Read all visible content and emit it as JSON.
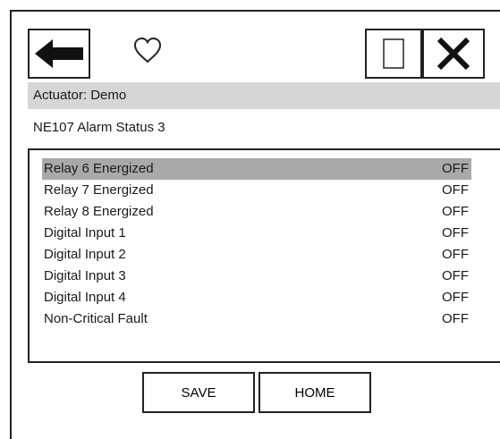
{
  "toolbar": {
    "back_icon": "back-arrow-icon",
    "favorite_icon": "heart-icon",
    "page_icon": "blank-page-icon",
    "close_icon": "close-x-icon"
  },
  "header": {
    "actuator_label": "Actuator: Demo"
  },
  "screen": {
    "title": "NE107 Alarm Status 3"
  },
  "list": {
    "items": [
      {
        "label": "Relay 6 Energized",
        "value": "OFF",
        "selected": true
      },
      {
        "label": "Relay 7 Energized",
        "value": "OFF",
        "selected": false
      },
      {
        "label": "Relay 8 Energized",
        "value": "OFF",
        "selected": false
      },
      {
        "label": "Digital Input 1",
        "value": "OFF",
        "selected": false
      },
      {
        "label": "Digital Input 2",
        "value": "OFF",
        "selected": false
      },
      {
        "label": "Digital Input 3",
        "value": "OFF",
        "selected": false
      },
      {
        "label": "Digital Input 4",
        "value": "OFF",
        "selected": false
      },
      {
        "label": "Non-Critical Fault",
        "value": "OFF",
        "selected": false
      }
    ]
  },
  "buttons": {
    "save_label": "SAVE",
    "home_label": "HOME"
  },
  "colors": {
    "header_bg": "#d6d6d6",
    "selected_row_bg": "#a9a9a9",
    "border": "#222222"
  }
}
